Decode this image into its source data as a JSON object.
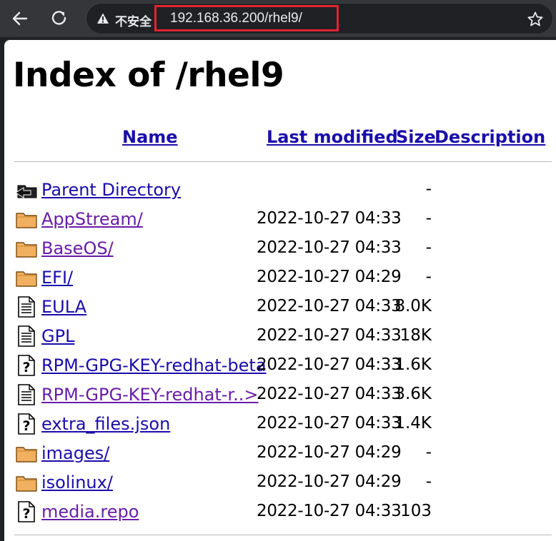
{
  "browser": {
    "security_label": "不安全",
    "url": "192.168.36.200/rhel9/",
    "back_icon": "arrow-left-icon",
    "reload_icon": "reload-icon",
    "warning_icon": "warning-triangle-icon",
    "bookmark_icon": "star-icon",
    "highlight_color": "#e02430"
  },
  "page": {
    "title": "Index of /rhel9",
    "columns": {
      "name": "Name",
      "last_modified": "Last modified",
      "size": "Size",
      "description": "Description"
    },
    "rows": [
      {
        "icon": "back-folder-icon",
        "name": "Parent Directory",
        "modified": "",
        "size": "-",
        "visited": false
      },
      {
        "icon": "folder-icon",
        "name": "AppStream/",
        "modified": "2022-10-27 04:33",
        "size": "-",
        "visited": true
      },
      {
        "icon": "folder-icon",
        "name": "BaseOS/",
        "modified": "2022-10-27 04:33",
        "size": "-",
        "visited": true
      },
      {
        "icon": "folder-icon",
        "name": "EFI/",
        "modified": "2022-10-27 04:29",
        "size": "-",
        "visited": false
      },
      {
        "icon": "text-file-icon",
        "name": "EULA",
        "modified": "2022-10-27 04:33",
        "size": "8.0K",
        "visited": false
      },
      {
        "icon": "text-file-icon",
        "name": "GPL",
        "modified": "2022-10-27 04:33",
        "size": "18K",
        "visited": false
      },
      {
        "icon": "unknown-file-icon",
        "name": "RPM-GPG-KEY-redhat-beta",
        "modified": "2022-10-27 04:33",
        "size": "1.6K",
        "visited": false
      },
      {
        "icon": "text-file-icon",
        "name": "RPM-GPG-KEY-redhat-r..>",
        "modified": "2022-10-27 04:33",
        "size": "3.6K",
        "visited": true
      },
      {
        "icon": "unknown-file-icon",
        "name": "extra_files.json",
        "modified": "2022-10-27 04:33",
        "size": "1.4K",
        "visited": false
      },
      {
        "icon": "folder-icon",
        "name": "images/",
        "modified": "2022-10-27 04:29",
        "size": "-",
        "visited": false
      },
      {
        "icon": "folder-icon",
        "name": "isolinux/",
        "modified": "2022-10-27 04:29",
        "size": "-",
        "visited": false
      },
      {
        "icon": "unknown-file-icon",
        "name": "media.repo",
        "modified": "2022-10-27 04:33",
        "size": "103",
        "visited": true
      }
    ]
  },
  "colors": {
    "link": "#1a0dab",
    "visited_link": "#681da8",
    "folder_fill": "#f0b060"
  }
}
